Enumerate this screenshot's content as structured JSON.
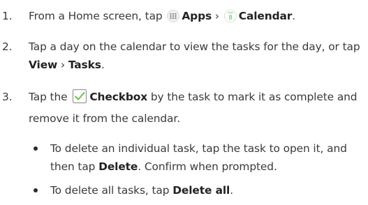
{
  "steps": [
    {
      "number": "1.",
      "parts": {
        "a": "From a Home screen, tap",
        "apps": "Apps",
        "sep": "›",
        "calendar": "Calendar",
        "end": "."
      }
    },
    {
      "number": "2.",
      "parts": {
        "a": "Tap a day on the calendar to view the tasks for the day, or tap",
        "view": "View",
        "sep": "›",
        "tasks": "Tasks",
        "end": "."
      }
    },
    {
      "number": "3.",
      "parts": {
        "a": "Tap the",
        "checkbox": "Checkbox",
        "b": "by the task to mark it as complete and remove it from the calendar."
      }
    }
  ],
  "bullets": [
    {
      "a": "To delete an individual task, tap the task to open it, and then tap",
      "delete": "Delete",
      "b": ". Confirm when prompted."
    },
    {
      "a": "To delete all tasks, tap",
      "delete_all": "Delete all",
      "b": "."
    }
  ],
  "icons": {
    "apps": "apps-grid-icon",
    "calendar": "calendar-app-icon",
    "calendar_day": "8",
    "calendar_month": "MON",
    "checkbox": "checkbox-icon"
  },
  "colors": {
    "text": "#3a3a3a",
    "calendar_green": "#5cb85c",
    "checkbox_green": "#6bbf4e"
  }
}
